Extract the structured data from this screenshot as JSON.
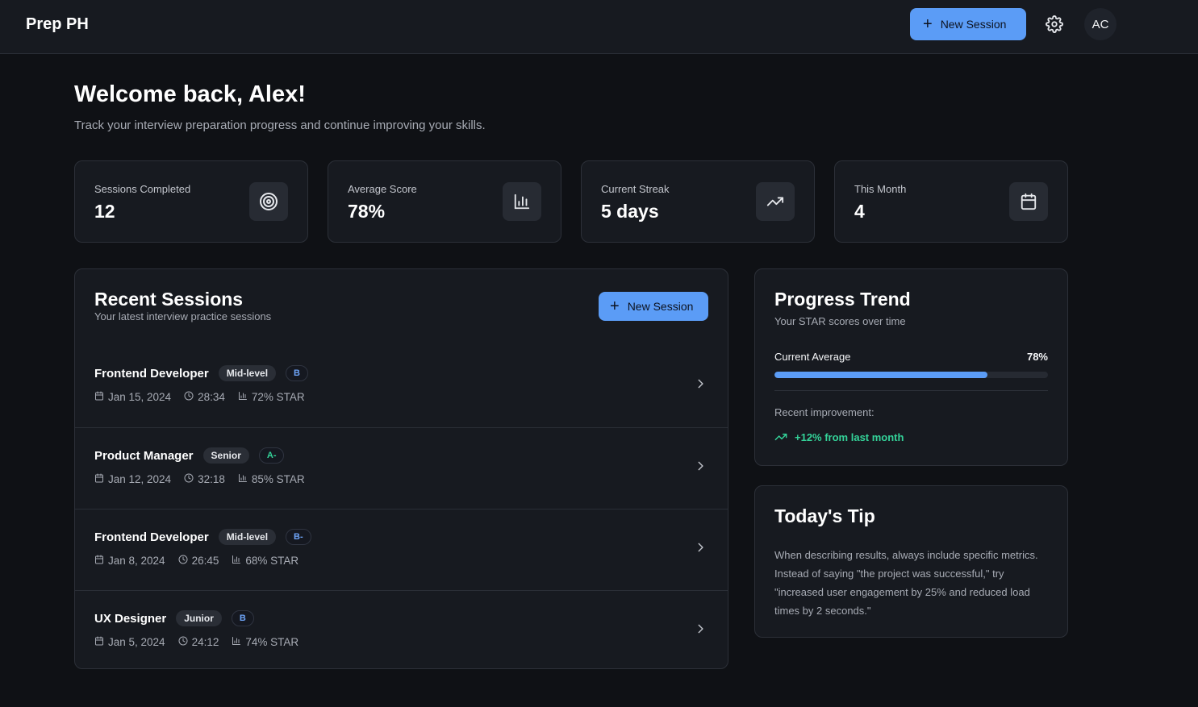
{
  "header": {
    "brand": "Prep PH",
    "new_session_label": "New Session",
    "avatar_initials": "AC"
  },
  "welcome": {
    "title": "Welcome back, Alex!",
    "subtitle": "Track your interview preparation progress and continue improving your skills."
  },
  "stats": [
    {
      "label": "Sessions Completed",
      "value": "12",
      "icon": "target-icon"
    },
    {
      "label": "Average Score",
      "value": "78%",
      "icon": "bar-chart-icon"
    },
    {
      "label": "Current Streak",
      "value": "5 days",
      "icon": "trending-up-icon"
    },
    {
      "label": "This Month",
      "value": "4",
      "icon": "calendar-icon"
    }
  ],
  "recent": {
    "title": "Recent Sessions",
    "subtitle": "Your latest interview practice sessions",
    "new_session_label": "New Session",
    "sessions": [
      {
        "title": "Frontend Developer",
        "level": "Mid-level",
        "grade": "B",
        "grade_color": "#6ea4f7",
        "date": "Jan 15, 2024",
        "duration": "28:34",
        "star": "72% STAR"
      },
      {
        "title": "Product Manager",
        "level": "Senior",
        "grade": "A-",
        "grade_color": "#34d399",
        "date": "Jan 12, 2024",
        "duration": "32:18",
        "star": "85% STAR"
      },
      {
        "title": "Frontend Developer",
        "level": "Mid-level",
        "grade": "B-",
        "grade_color": "#6ea4f7",
        "date": "Jan 8, 2024",
        "duration": "26:45",
        "star": "68% STAR"
      },
      {
        "title": "UX Designer",
        "level": "Junior",
        "grade": "B",
        "grade_color": "#6ea4f7",
        "date": "Jan 5, 2024",
        "duration": "24:12",
        "star": "74% STAR"
      }
    ]
  },
  "progress": {
    "title": "Progress Trend",
    "subtitle": "Your STAR scores over time",
    "current_label": "Current Average",
    "current_value": "78%",
    "current_fraction": 0.78,
    "improvement_label": "Recent improvement:",
    "improvement_value": "+12% from last month",
    "improvement_color": "#34d399"
  },
  "tip": {
    "title": "Today's Tip",
    "text": "When describing results, always include specific metrics. Instead of saying \"the project was successful,\" try \"increased user engagement by 25% and reduced load times by 2 seconds.\""
  },
  "colors": {
    "accent": "#5b9cf6",
    "background": "#0f1115",
    "card": "#171a20"
  }
}
